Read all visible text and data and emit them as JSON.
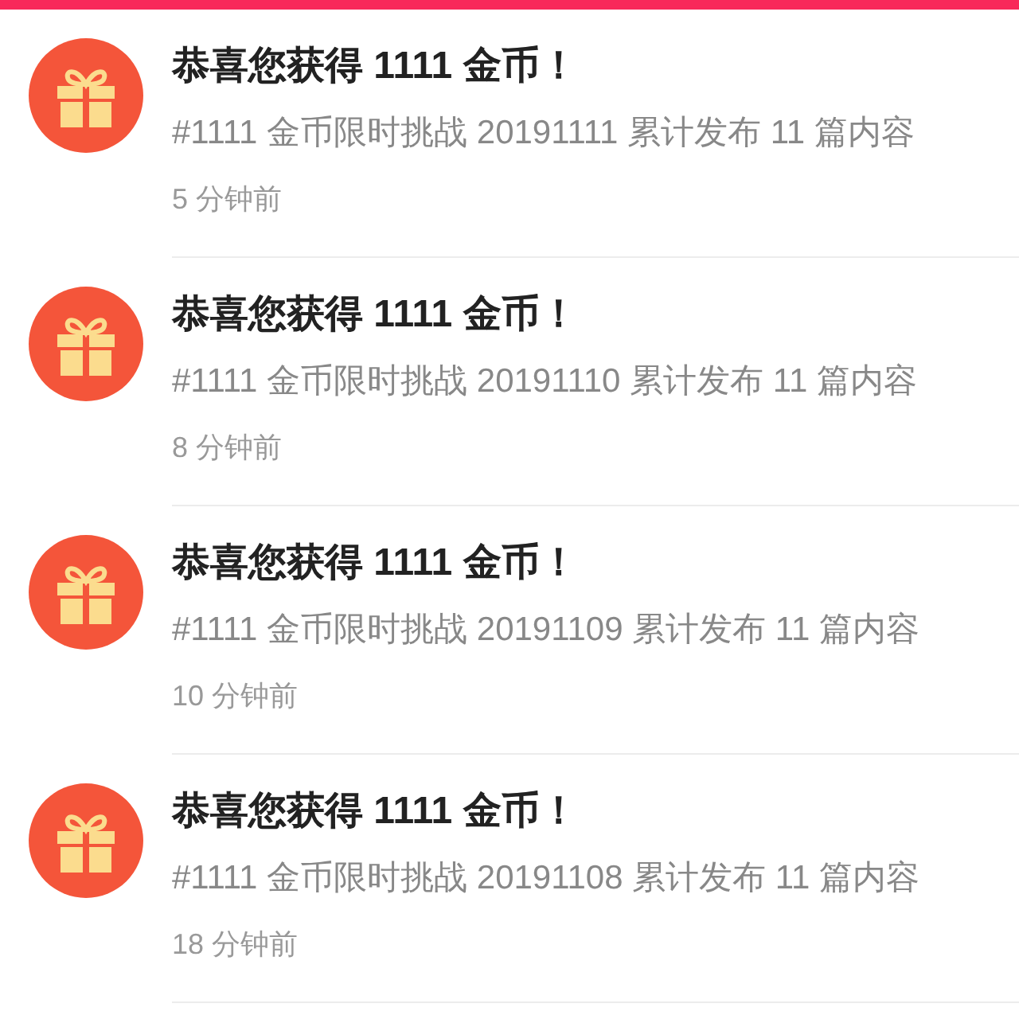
{
  "notifications": [
    {
      "title": "恭喜您获得 1111 金币！",
      "message": "#1111 金币限时挑战 20191111 累计发布 11 篇内容",
      "time": "5 分钟前"
    },
    {
      "title": "恭喜您获得 1111 金币！",
      "message": "#1111 金币限时挑战 20191110 累计发布 11 篇内容",
      "time": "8 分钟前"
    },
    {
      "title": "恭喜您获得 1111 金币！",
      "message": "#1111 金币限时挑战 20191109 累计发布 11 篇内容",
      "time": "10 分钟前"
    },
    {
      "title": "恭喜您获得 1111 金币！",
      "message": "#1111 金币限时挑战 20191108 累计发布 11 篇内容",
      "time": "18 分钟前"
    }
  ]
}
